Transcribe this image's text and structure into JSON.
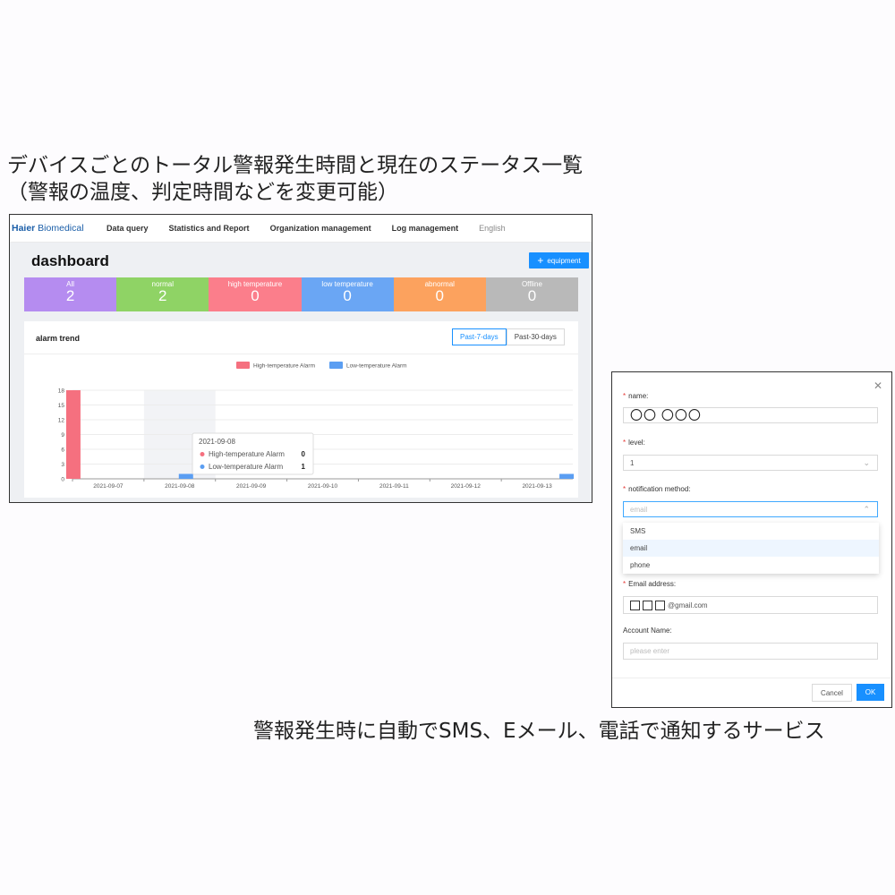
{
  "captions": {
    "top_line1": "デバイスごとのトータル警報発生時間と現在のステータス一覧",
    "top_line2": "（警報の温度、判定時間などを変更可能）",
    "bottom": "警報発生時に自動でSMS、Eメール、電話で通知するサービス"
  },
  "nav": {
    "logo_brand": "Haier",
    "logo_rest": " Biomedical",
    "items": [
      "Data query",
      "Statistics and Report",
      "Organization management",
      "Log management"
    ],
    "language": "English"
  },
  "dashboard": {
    "title": "dashboard",
    "add_button": "equipment",
    "cards": [
      {
        "label": "All",
        "value": "2",
        "color": "#b58cf0"
      },
      {
        "label": "normal",
        "value": "2",
        "color": "#8fd365"
      },
      {
        "label": "high temperature",
        "value": "0",
        "color": "#fb7e8b"
      },
      {
        "label": "low temperature",
        "value": "0",
        "color": "#6aa6f4"
      },
      {
        "label": "abnormal",
        "value": "0",
        "color": "#fca25e"
      },
      {
        "label": "Offline",
        "value": "0",
        "color": "#b9b9b9"
      }
    ],
    "chart_title": "alarm trend",
    "range_buttons": [
      "Past-7-days",
      "Past-30-days"
    ],
    "tooltip": {
      "date": "2021-09-08",
      "rows": [
        {
          "label": "High-temperature Alarm",
          "value": "0",
          "color": "#f5707f"
        },
        {
          "label": "Low-temperature Alarm",
          "value": "1",
          "color": "#5b9ef2"
        }
      ]
    }
  },
  "chart_data": {
    "type": "bar",
    "title": "alarm trend",
    "categories": [
      "2021-09-07",
      "2021-09-08",
      "2021-09-09",
      "2021-09-10",
      "2021-09-11",
      "2021-09-12",
      "2021-09-13"
    ],
    "series": [
      {
        "name": "High-temperature Alarm",
        "color": "#f5707f",
        "values": [
          18,
          0,
          0,
          0,
          0,
          0,
          0
        ]
      },
      {
        "name": "Low-temperature Alarm",
        "color": "#5b9ef2",
        "values": [
          0,
          1,
          0,
          0,
          0,
          0,
          1
        ]
      }
    ],
    "yticks": [
      0,
      3,
      6,
      9,
      12,
      15,
      18
    ],
    "ylim": [
      0,
      18
    ],
    "legend": "top-center",
    "grid": true,
    "highlighted_category": "2021-09-08"
  },
  "dialog": {
    "name_label": "name",
    "name_value": "〇〇 〇〇〇",
    "level_label": "level",
    "level_value": "1",
    "method_label": "notification method",
    "method_value": "email",
    "method_options": [
      "SMS",
      "email",
      "phone"
    ],
    "email_label": "Email address",
    "email_suffix": "@gmail.com",
    "account_label": "Account Name",
    "account_placeholder": "please enter",
    "cancel": "Cancel",
    "ok": "OK"
  }
}
